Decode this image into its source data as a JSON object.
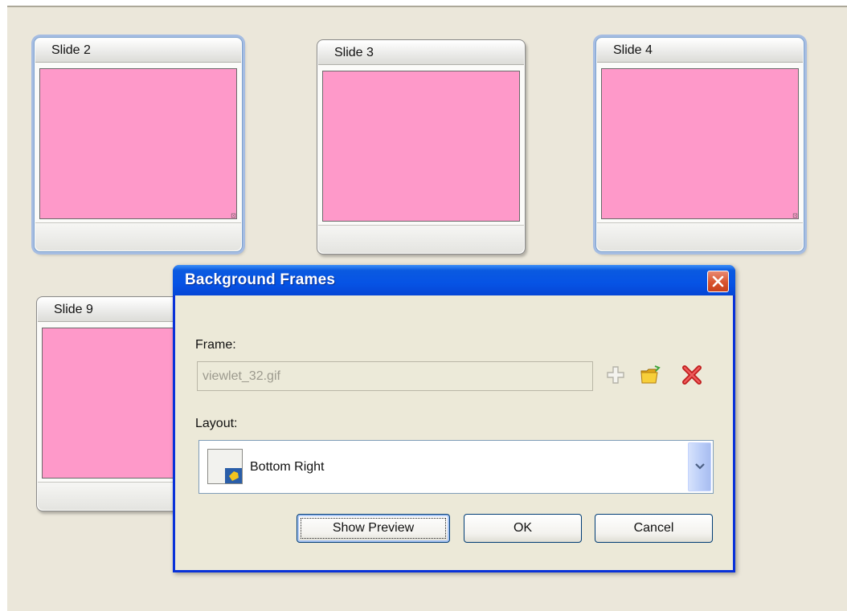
{
  "slides": [
    {
      "title": "Slide 2",
      "selected": true
    },
    {
      "title": "Slide 3",
      "selected": false
    },
    {
      "title": "Slide 4",
      "selected": true
    },
    {
      "title": "Slide 9",
      "selected": false
    }
  ],
  "slide_color": "#fe99c9",
  "dialog": {
    "title": "Background Frames",
    "frame_label": "Frame:",
    "frame_value": "viewlet_32.gif",
    "icons": [
      "add-icon",
      "open-folder-icon",
      "delete-icon"
    ],
    "layout_label": "Layout:",
    "layout_value": "Bottom Right",
    "buttons": {
      "preview": "Show Preview",
      "ok": "OK",
      "cancel": "Cancel"
    }
  },
  "colors": {
    "titlebar": "#0653e5",
    "dialog_bg": "#ece9d8",
    "desktop_bg": "#ebe7da"
  }
}
